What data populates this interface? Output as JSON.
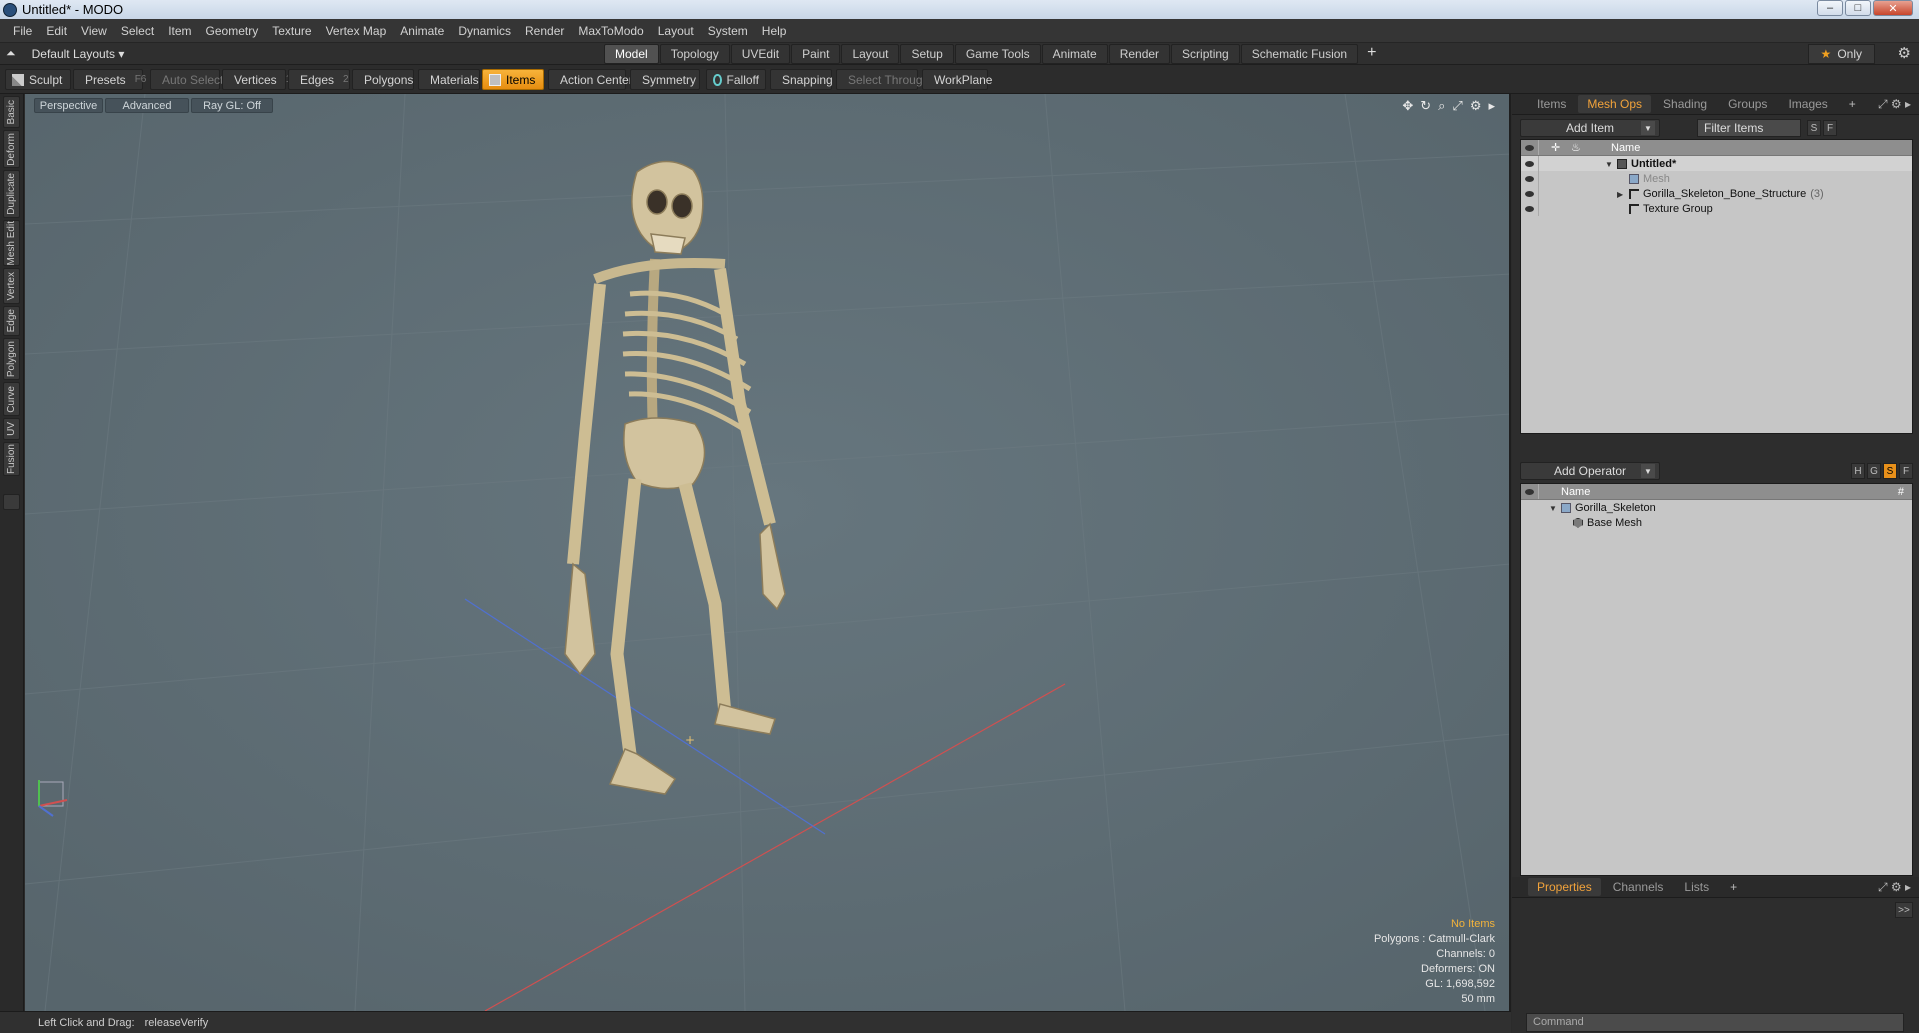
{
  "window": {
    "title": "Untitled* - MODO"
  },
  "menu": [
    "File",
    "Edit",
    "View",
    "Select",
    "Item",
    "Geometry",
    "Texture",
    "Vertex Map",
    "Animate",
    "Dynamics",
    "Render",
    "MaxToModo",
    "Layout",
    "System",
    "Help"
  ],
  "layout": {
    "dropdown": "Default Layouts",
    "tabs": [
      "Model",
      "Topology",
      "UVEdit",
      "Paint",
      "Layout",
      "Setup",
      "Game Tools",
      "Animate",
      "Render",
      "Scripting",
      "Schematic Fusion"
    ],
    "active_tab": "Model",
    "only_label": "Only"
  },
  "toolbar": {
    "sculpt": "Sculpt",
    "presets": "Presets",
    "presets_key": "F6",
    "auto_select": "Auto Select",
    "vertices": "Vertices",
    "vertices_key": "1",
    "edges": "Edges",
    "edges_key": "2",
    "polygons": "Polygons",
    "materials": "Materials",
    "items": "Items",
    "action_center": "Action Center",
    "symmetry": "Symmetry",
    "falloff": "Falloff",
    "snapping": "Snapping",
    "select_through": "Select Through",
    "workplane": "WorkPlane"
  },
  "left_tabs": [
    "Basic",
    "Deform",
    "Duplicate",
    "Mesh Edit",
    "Vertex",
    "Edge",
    "Polygon",
    "Curve",
    "UV",
    "Fusion"
  ],
  "viewport": {
    "view": "Perspective",
    "shading": "Advanced",
    "raygl": "Ray GL: Off",
    "stats": {
      "items": "No Items",
      "polygons": "Polygons : Catmull-Clark",
      "channels": "Channels: 0",
      "deformers": "Deformers: ON",
      "gl": "GL: 1,698,592",
      "scale": "50 mm"
    }
  },
  "status": {
    "hint": "Left Click and Drag:",
    "action": "releaseVerify"
  },
  "item_panel": {
    "tabs": [
      "Items",
      "Mesh Ops",
      "Shading",
      "Groups",
      "Images"
    ],
    "active_tab": "Mesh Ops",
    "add_item": "Add Item",
    "filter": "Filter Items",
    "s_btn": "S",
    "f_btn": "F",
    "column_name": "Name",
    "rows": [
      {
        "label": "Untitled*"
      },
      {
        "label": "Mesh"
      },
      {
        "label": "Gorilla_Skeleton_Bone_Structure",
        "count": "(3)"
      },
      {
        "label": "Texture Group"
      }
    ]
  },
  "ops_panel": {
    "add_operator": "Add Operator",
    "buttons": [
      "H",
      "G",
      "S",
      "F"
    ],
    "column_name": "Name",
    "column_hash": "#",
    "rows": [
      {
        "label": "Gorilla_Skeleton"
      },
      {
        "label": "Base Mesh"
      }
    ]
  },
  "bottom_panel": {
    "tabs": [
      "Properties",
      "Channels",
      "Lists"
    ],
    "active_tab": "Properties",
    "command_placeholder": "Command",
    "expand_label": ">>"
  },
  "colors": {
    "accent": "#f2a33b",
    "viewport_bg": "#5c6b73",
    "bone": "#d2c39e",
    "x_axis": "#d05050",
    "z_axis": "#5070d0"
  }
}
